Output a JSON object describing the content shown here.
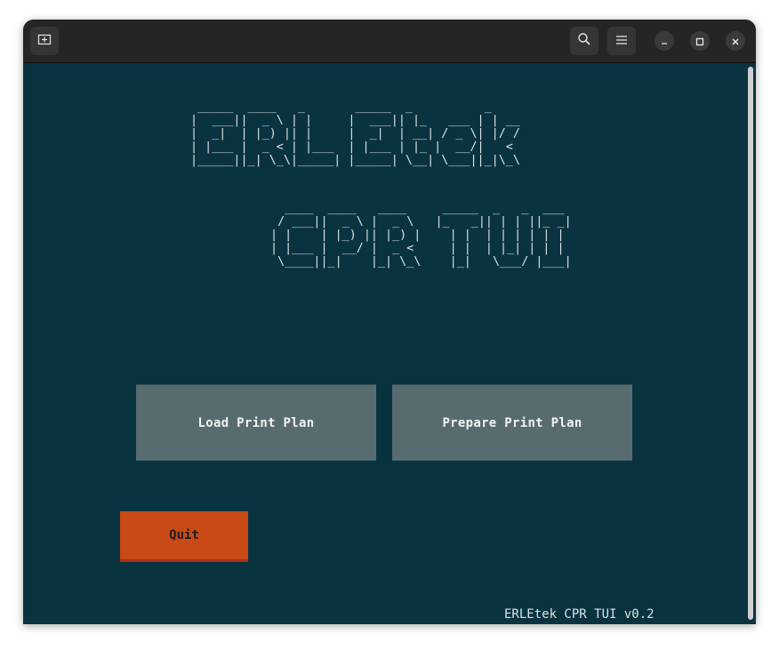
{
  "titlebar": {
    "new_tab_icon": "new-tab-icon",
    "search_icon": "search-icon",
    "menu_icon": "hamburger-menu-icon",
    "minimize_icon": "minimize-icon",
    "maximize_icon": "maximize-icon",
    "close_icon": "close-icon"
  },
  "banner": {
    "erletek_art": "  _____  ____   _       _____  _          _\n |  ___||  _ \\ | |     |  ___|| |_   ___ | | __\n |  _|  | |_) || |     |  _|  | __| / _ \\| |/ /\n | |___ |  _ < | |___  | |___ | |_ |  __/|   <\n |_____||_| \\_\\|_____| |_____| \\__| \\___||_|\\_\\",
    "cpr_tui_art": "   ____  ____   ____     _____  _   _  ___\n  / ___||  _ \\ |  _ \\   |_   _|| | | ||_ _|\n | |    | |_) || |_) |    | |  | | | | | |\n | |___ |  __/ |  _ <     | |  | |_| | | |\n  \\____||_|    |_| \\_\\    |_|   \\___/ |___|"
  },
  "buttons": {
    "load": "Load Print Plan",
    "prepare": "Prepare Print Plan",
    "quit": "Quit"
  },
  "footer": {
    "version": "ERLEtek CPR TUI v0.2"
  },
  "colors": {
    "background": "#0a3340",
    "button": "#586c70",
    "quit": "#c84a17",
    "titlebar": "#252525"
  }
}
